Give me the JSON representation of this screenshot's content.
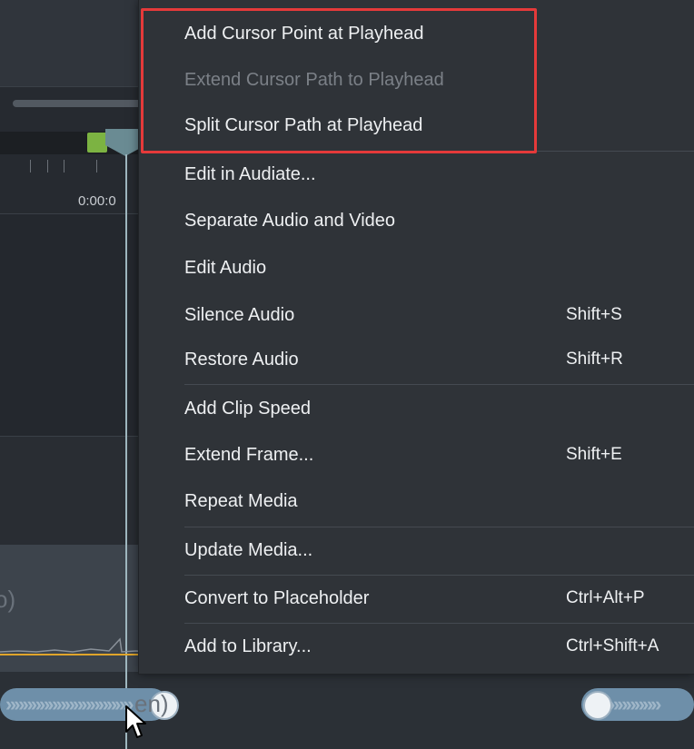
{
  "timeline": {
    "time_label": "0:00:0",
    "audio_track_label": "o)",
    "screen_track_label": "en)"
  },
  "colors": {
    "menu_bg": "#2f3338",
    "highlight": "#e53a3a",
    "playhead": "#6a8b93",
    "marker": "#7cb342",
    "waveform_line": "#e0a52a"
  },
  "context_menu": {
    "items": [
      {
        "label": "Add Cursor Point at Playhead",
        "shortcut": "",
        "enabled": true
      },
      {
        "label": "Extend Cursor Path to Playhead",
        "shortcut": "",
        "enabled": false
      },
      {
        "label": "Split Cursor Path at Playhead",
        "shortcut": "",
        "enabled": true
      },
      {
        "label": "Edit in Audiate...",
        "shortcut": "",
        "enabled": true
      },
      {
        "label": "Separate Audio and Video",
        "shortcut": "",
        "enabled": true
      },
      {
        "label": "Edit Audio",
        "shortcut": "",
        "enabled": true
      },
      {
        "label": "Silence Audio",
        "shortcut": "Shift+S",
        "enabled": true
      },
      {
        "label": "Restore Audio",
        "shortcut": "Shift+R",
        "enabled": true
      },
      {
        "label": "Add Clip Speed",
        "shortcut": "",
        "enabled": true
      },
      {
        "label": "Extend Frame...",
        "shortcut": "Shift+E",
        "enabled": true
      },
      {
        "label": "Repeat Media",
        "shortcut": "",
        "enabled": true
      },
      {
        "label": "Update Media...",
        "shortcut": "",
        "enabled": true
      },
      {
        "label": "Convert to Placeholder",
        "shortcut": "Ctrl+Alt+P",
        "enabled": true
      },
      {
        "label": "Add to Library...",
        "shortcut": "Ctrl+Shift+A",
        "enabled": true
      }
    ]
  }
}
